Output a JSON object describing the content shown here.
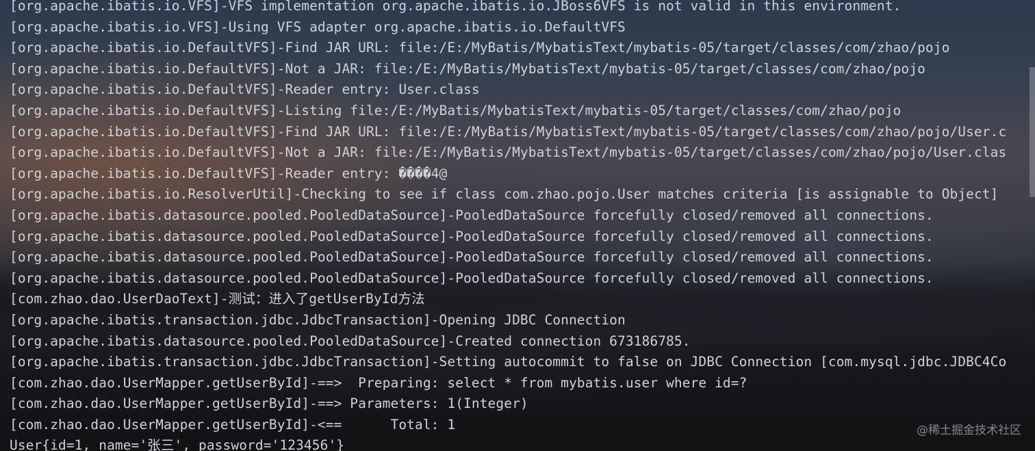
{
  "console": {
    "lines": [
      "[org.apache.ibatis.io.VFS]-VFS implementation org.apache.ibatis.io.JBoss6VFS is not valid in this environment.",
      "[org.apache.ibatis.io.VFS]-Using VFS adapter org.apache.ibatis.io.DefaultVFS",
      "[org.apache.ibatis.io.DefaultVFS]-Find JAR URL: file:/E:/MyBatis/MybatisText/mybatis-05/target/classes/com/zhao/pojo",
      "[org.apache.ibatis.io.DefaultVFS]-Not a JAR: file:/E:/MyBatis/MybatisText/mybatis-05/target/classes/com/zhao/pojo",
      "[org.apache.ibatis.io.DefaultVFS]-Reader entry: User.class",
      "[org.apache.ibatis.io.DefaultVFS]-Listing file:/E:/MyBatis/MybatisText/mybatis-05/target/classes/com/zhao/pojo",
      "[org.apache.ibatis.io.DefaultVFS]-Find JAR URL: file:/E:/MyBatis/MybatisText/mybatis-05/target/classes/com/zhao/pojo/User.c",
      "[org.apache.ibatis.io.DefaultVFS]-Not a JAR: file:/E:/MyBatis/MybatisText/mybatis-05/target/classes/com/zhao/pojo/User.clas",
      "[org.apache.ibatis.io.DefaultVFS]-Reader entry: ����4@",
      "[org.apache.ibatis.io.ResolverUtil]-Checking to see if class com.zhao.pojo.User matches criteria [is assignable to Object]",
      "[org.apache.ibatis.datasource.pooled.PooledDataSource]-PooledDataSource forcefully closed/removed all connections.",
      "[org.apache.ibatis.datasource.pooled.PooledDataSource]-PooledDataSource forcefully closed/removed all connections.",
      "[org.apache.ibatis.datasource.pooled.PooledDataSource]-PooledDataSource forcefully closed/removed all connections.",
      "[org.apache.ibatis.datasource.pooled.PooledDataSource]-PooledDataSource forcefully closed/removed all connections.",
      "[com.zhao.dao.UserDaoText]-测试：进入了getUserById方法",
      "[org.apache.ibatis.transaction.jdbc.JdbcTransaction]-Opening JDBC Connection",
      "[org.apache.ibatis.datasource.pooled.PooledDataSource]-Created connection 673186785.",
      "[org.apache.ibatis.transaction.jdbc.JdbcTransaction]-Setting autocommit to false on JDBC Connection [com.mysql.jdbc.JDBC4Co",
      "[com.zhao.dao.UserMapper.getUserById]-==>  Preparing: select * from mybatis.user where id=?",
      "[com.zhao.dao.UserMapper.getUserById]-==> Parameters: 1(Integer)",
      "[com.zhao.dao.UserMapper.getUserById]-<==      Total: 1",
      "User{id=1, name='张三', password='123456'}"
    ]
  },
  "watermark": "@稀土掘金技术社区",
  "colors": {
    "text": "#cfd3d8"
  }
}
